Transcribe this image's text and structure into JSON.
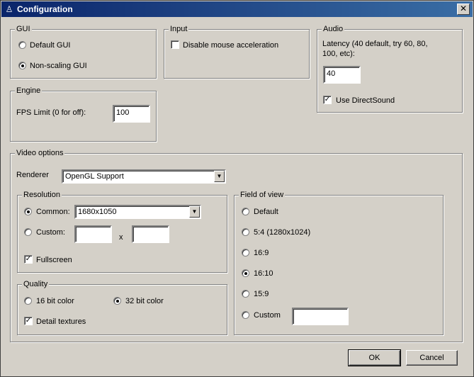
{
  "window": {
    "title": "Configuration",
    "close_glyph": "✕"
  },
  "gui": {
    "legend": "GUI",
    "options": [
      {
        "label": "Default GUI",
        "selected": false
      },
      {
        "label": "Non-scaling GUI",
        "selected": true
      }
    ]
  },
  "input": {
    "legend": "Input",
    "disable_mouse_accel": {
      "label": "Disable mouse acceleration",
      "checked": false
    }
  },
  "audio": {
    "legend": "Audio",
    "latency_label": "Latency (40 default, try 60, 80, 100, etc):",
    "latency_value": "40",
    "directsound": {
      "label": "Use DirectSound",
      "checked": true
    }
  },
  "engine": {
    "legend": "Engine",
    "fps_label": "FPS Limit (0 for off):",
    "fps_value": "100"
  },
  "video": {
    "legend": "Video options",
    "renderer_label": "Renderer",
    "renderer_value": "OpenGL Support",
    "resolution": {
      "legend": "Resolution",
      "common_label": "Common:",
      "common_selected": true,
      "common_value": "1680x1050",
      "custom_label": "Custom:",
      "custom_selected": false,
      "custom_width": "",
      "custom_height": "",
      "x_label": "x",
      "fullscreen": {
        "label": "Fullscreen",
        "checked": true
      }
    },
    "quality": {
      "legend": "Quality",
      "bit16": {
        "label": "16 bit color",
        "selected": false
      },
      "bit32": {
        "label": "32 bit color",
        "selected": true
      },
      "detail_textures": {
        "label": "Detail textures",
        "checked": true
      }
    },
    "fov": {
      "legend": "Field of view",
      "options": [
        {
          "label": "Default",
          "selected": false
        },
        {
          "label": "5:4 (1280x1024)",
          "selected": false
        },
        {
          "label": "16:9",
          "selected": false
        },
        {
          "label": "16:10",
          "selected": true
        },
        {
          "label": "15:9",
          "selected": false
        },
        {
          "label": "Custom",
          "selected": false
        }
      ],
      "custom_value": ""
    }
  },
  "buttons": {
    "ok": "OK",
    "cancel": "Cancel"
  },
  "glyphs": {
    "check": "✓",
    "dropdown": "▼"
  }
}
